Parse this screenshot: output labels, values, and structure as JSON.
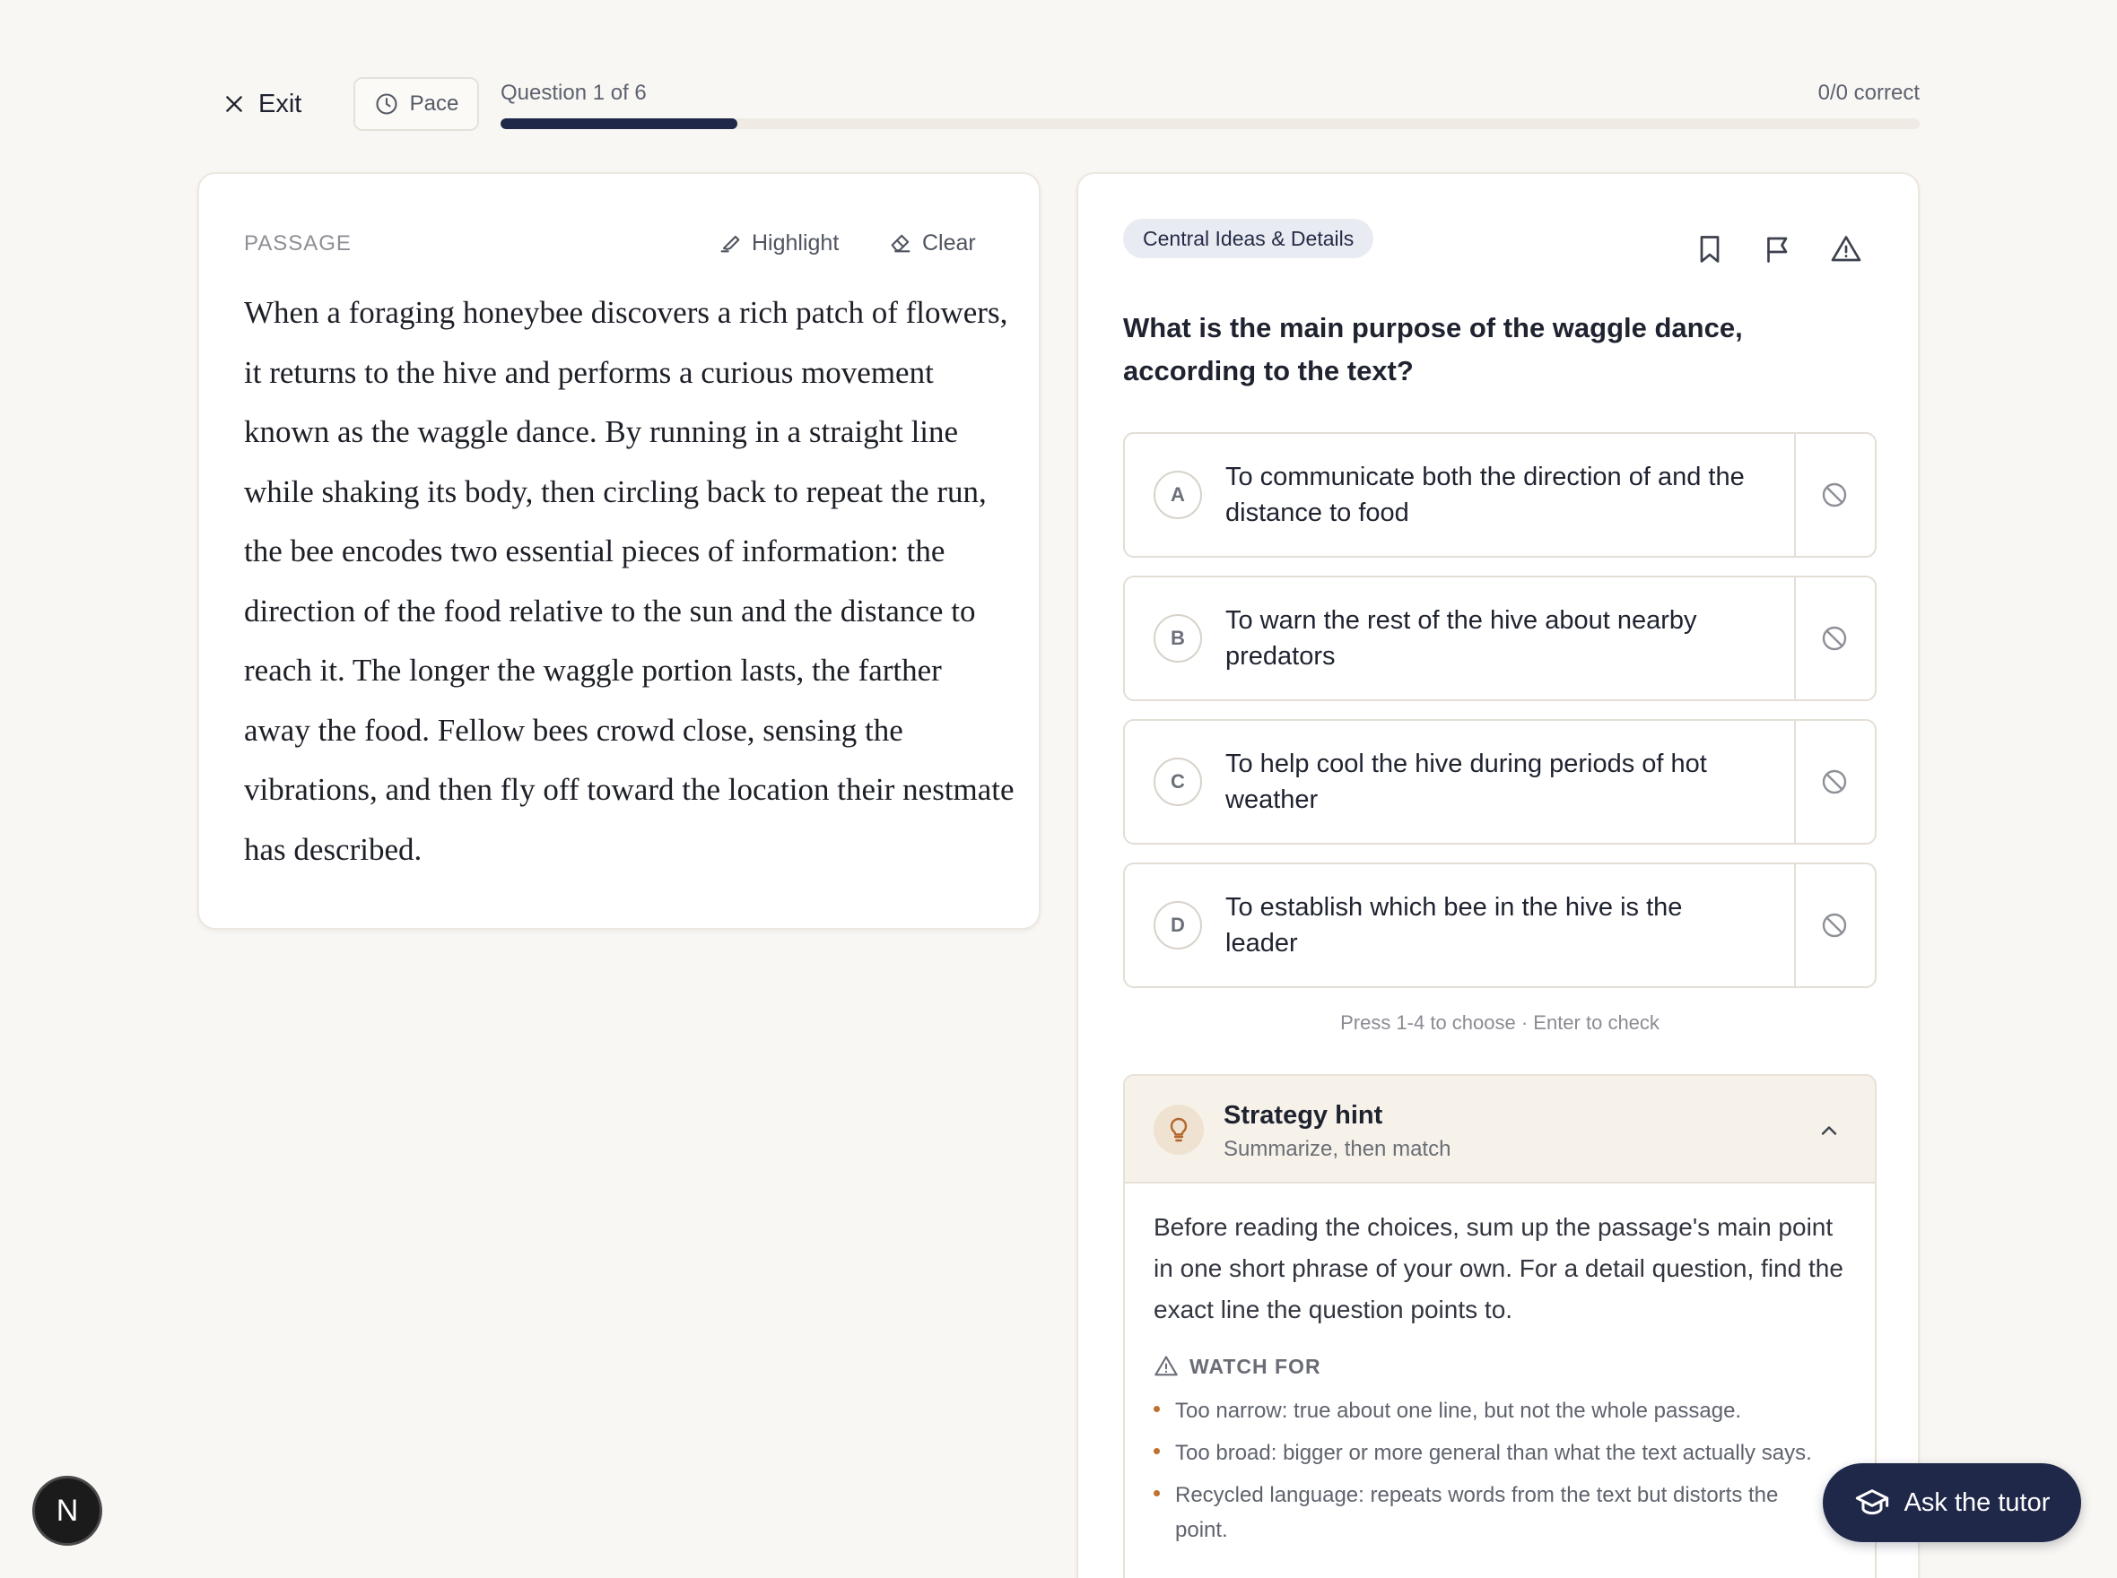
{
  "header": {
    "exit_label": "Exit",
    "pace_label": "Pace",
    "question_counter": "Question 1 of 6",
    "score": "0/0 correct",
    "progress_fraction": 0.1667
  },
  "passage": {
    "label": "PASSAGE",
    "highlight_label": "Highlight",
    "clear_label": "Clear",
    "text": "When a foraging honeybee discovers a rich patch of flowers, it returns to the hive and performs a curious movement known as the waggle dance. By running in a straight line while shaking its body, then circling back to repeat the run, the bee encodes two essential pieces of information: the direction of the food relative to the sun and the distance to reach it. The longer the waggle portion lasts, the farther away the food. Fellow bees crowd close, sensing the vibrations, and then fly off toward the location their nestmate has described."
  },
  "question": {
    "category": "Central Ideas & Details",
    "text": "What is the main purpose of the waggle dance, according to the text?",
    "choices": [
      {
        "letter": "A",
        "text": "To communicate both the direction of and the distance to food"
      },
      {
        "letter": "B",
        "text": "To warn the rest of the hive about nearby predators"
      },
      {
        "letter": "C",
        "text": "To help cool the hive during periods of hot weather"
      },
      {
        "letter": "D",
        "text": "To establish which bee in the hive is the leader"
      }
    ],
    "keyboard_hint": "Press 1-4 to choose · Enter to check"
  },
  "hint": {
    "title": "Strategy hint",
    "subtitle": "Summarize, then match",
    "body": "Before reading the choices, sum up the passage's main point in one short phrase of your own. For a detail question, find the exact line the question points to.",
    "watch_label": "WATCH FOR",
    "watch_items": [
      "Too narrow: true about one line, but not the whole passage.",
      "Too broad: bigger or more general than what the text actually says.",
      "Recycled language: repeats words from the text but distorts the point."
    ]
  },
  "tutor_label": "Ask the tutor",
  "avatar_initial": "N",
  "colors": {
    "accent": "#1f2849",
    "hint_accent": "#c0712f",
    "background": "#f9f7f3"
  }
}
